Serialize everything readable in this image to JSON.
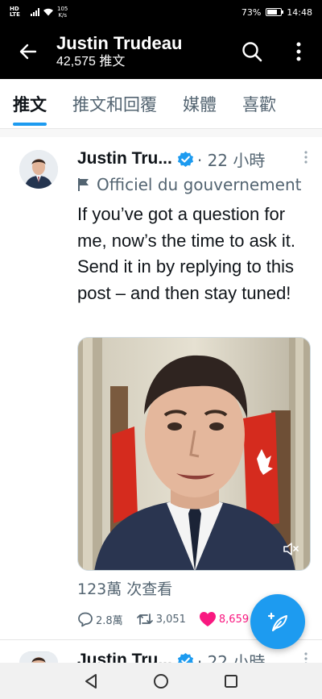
{
  "status_bar": {
    "network": "HD LTE",
    "speed_value": "105",
    "speed_unit": "K/s",
    "battery": "73%",
    "battery_level": 0.73,
    "time": "14:48"
  },
  "header": {
    "title": "Justin Trudeau",
    "subtitle": "42,575 推文"
  },
  "tabs": [
    {
      "label": "推文",
      "active": true
    },
    {
      "label": "推文和回覆",
      "active": false
    },
    {
      "label": "媒體",
      "active": false
    },
    {
      "label": "喜歡",
      "active": false
    }
  ],
  "tweet": {
    "author": "Justin Tru...",
    "time": "· 22 小時",
    "label": "Officiel du gouvernement",
    "text": "If you’ve got a question for me, now’s the time to ask it. Send it in by replying to this post – and then stay tuned!",
    "views": "123萬 次查看",
    "replies": "2.8萬",
    "retweets": "3,051",
    "likes": "8,659"
  },
  "next_tweet": {
    "author": "Justin Tru...",
    "time": "· 22 小時"
  },
  "colors": {
    "accent": "#1d9bf0",
    "like": "#f91880",
    "header_bg": "#000000"
  },
  "icons": {
    "back": "arrow-left-icon",
    "search": "search-icon",
    "more": "more-vertical-icon",
    "verified": "verified-badge-icon",
    "gov_flag": "flag-icon",
    "mute": "speaker-muted-icon",
    "reply": "reply-icon",
    "retweet": "retweet-icon",
    "like": "heart-icon",
    "compose": "compose-feather-icon"
  }
}
